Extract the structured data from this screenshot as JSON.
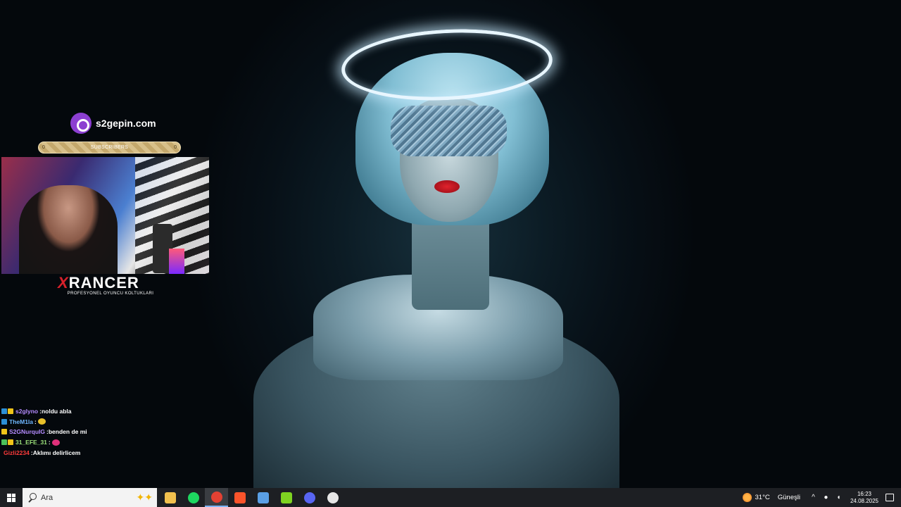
{
  "overlay": {
    "sponsor": {
      "site": "s2gepin.com",
      "icon": "s2gepin-logo-icon"
    },
    "sub_goal": {
      "label": "SUBSCRIBERS",
      "left_count": "0",
      "right_count": "0"
    },
    "brand": {
      "name_x": "X",
      "name_rest": "RANCER",
      "tagline": "PROFESYONEL OYUNCU KOLTUKLARI"
    }
  },
  "chat": [
    {
      "user": "s2glyno",
      "user_color": "#b58cff",
      "badges": [
        "#2d8fd5",
        "#f0c419"
      ],
      "message": "noldu abla",
      "emote": ""
    },
    {
      "user": "TheM1la",
      "user_color": "#6fb7ff",
      "badges": [
        "#2d8fd5"
      ],
      "message": "",
      "emote": "#e8c02a"
    },
    {
      "user": "S2GNurquIG",
      "user_color": "#b58cff",
      "badges": [
        "#f0c419"
      ],
      "message": "benden de mi",
      "emote": ""
    },
    {
      "user": "31_EFE_31",
      "user_color": "#9be07a",
      "badges": [
        "#4cc15a",
        "#f0c419"
      ],
      "message": "",
      "emote": "#e0307a"
    },
    {
      "user": "Gizli2234",
      "user_color": "#ff3b3b",
      "badges": [],
      "message": "Aklımı delirlicem",
      "emote": ""
    }
  ],
  "taskbar": {
    "search_placeholder": "Ara",
    "apps": [
      {
        "name": "file-explorer-icon",
        "color": "#f2c14e",
        "active": false
      },
      {
        "name": "spotify-icon",
        "color": "#1ed760",
        "active": false
      },
      {
        "name": "chrome-icon",
        "color": "#e34133",
        "active": true
      },
      {
        "name": "brave-icon",
        "color": "#fb542b",
        "active": false
      },
      {
        "name": "app-cube-icon",
        "color": "#5aa0e6",
        "active": false
      },
      {
        "name": "play-app-icon",
        "color": "#7ed321",
        "active": false
      },
      {
        "name": "discord-icon",
        "color": "#5865f2",
        "active": false
      },
      {
        "name": "obs-icon",
        "color": "#e6e6e6",
        "active": false
      }
    ],
    "weather": {
      "temp": "31°C",
      "condition": "Güneşli"
    },
    "time": "16:23",
    "date": "24.08.2025"
  }
}
